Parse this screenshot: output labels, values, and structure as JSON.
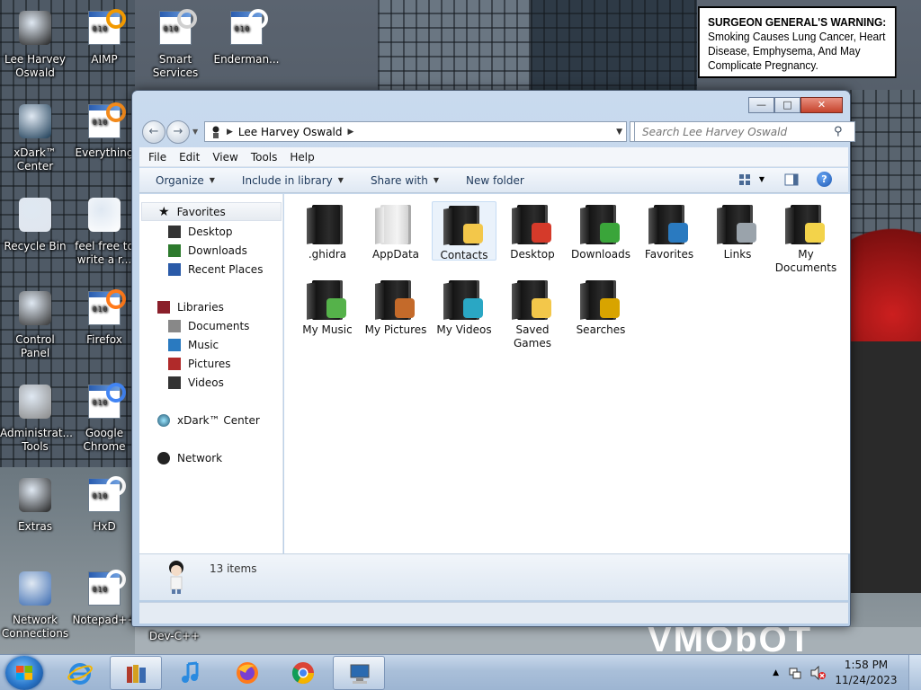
{
  "desktop": {
    "icons": [
      {
        "label": "Lee Harvey\nOswald",
        "icon": "l-avatar-icon"
      },
      {
        "label": "AIMP",
        "icon": "aimp-icon"
      },
      {
        "label": "Smart\nServices",
        "icon": "smart-services-icon"
      },
      {
        "label": "Enderman...",
        "icon": "enderman-icon"
      },
      {
        "label": "xDark™\nCenter",
        "icon": "xdark-center-icon"
      },
      {
        "label": "Everything",
        "icon": "everything-icon"
      },
      {
        "label": "Recycle Bin",
        "icon": "recycle-bin-icon"
      },
      {
        "label": "feel free to\nwrite a r...",
        "icon": "text-document-icon"
      },
      {
        "label": "Control Panel",
        "icon": "control-panel-icon"
      },
      {
        "label": "Firefox",
        "icon": "firefox-icon"
      },
      {
        "label": "Administrat...\nTools",
        "icon": "admin-tools-icon"
      },
      {
        "label": "Google\nChrome",
        "icon": "chrome-icon"
      },
      {
        "label": "Extras",
        "icon": "extras-icon"
      },
      {
        "label": "HxD",
        "icon": "hxd-icon"
      },
      {
        "label": "Network\nConnections",
        "icon": "network-connections-icon"
      },
      {
        "label": "Notepad++",
        "icon": "notepadpp-icon"
      },
      {
        "label": "Dev-C++",
        "icon": "devcpp-icon"
      }
    ],
    "warning": {
      "bold": "SURGEON GENERAL'S WARNING:",
      "text": " Smoking Causes Lung Cancer, Heart Disease, Emphysema, And May Complicate Pregnancy."
    },
    "wallpaper_text": "VMObOT"
  },
  "window": {
    "address": {
      "path": "Lee Harvey Oswald"
    },
    "search": {
      "placeholder": "Search Lee Harvey Oswald"
    },
    "menu": [
      "File",
      "Edit",
      "View",
      "Tools",
      "Help"
    ],
    "commands": {
      "organize": "Organize",
      "include": "Include in library",
      "share": "Share with",
      "new_folder": "New folder"
    },
    "nav": {
      "favorites": "Favorites",
      "fav_items": [
        "Desktop",
        "Downloads",
        "Recent Places"
      ],
      "libraries": "Libraries",
      "lib_items": [
        "Documents",
        "Music",
        "Pictures",
        "Videos"
      ],
      "xdark": "xDark™ Center",
      "network": "Network"
    },
    "items": [
      {
        "name": ".ghidra",
        "style": "dark"
      },
      {
        "name": "AppData",
        "style": "light"
      },
      {
        "name": "Contacts",
        "style": "dark",
        "selected": true
      },
      {
        "name": "Desktop",
        "style": "dark"
      },
      {
        "name": "Downloads",
        "style": "dark"
      },
      {
        "name": "Favorites",
        "style": "dark"
      },
      {
        "name": "Links",
        "style": "dark"
      },
      {
        "name": "My\nDocuments",
        "style": "dark"
      },
      {
        "name": "My Music",
        "style": "dark"
      },
      {
        "name": "My Pictures",
        "style": "dark"
      },
      {
        "name": "My Videos",
        "style": "dark"
      },
      {
        "name": "Saved\nGames",
        "style": "dark"
      },
      {
        "name": "Searches",
        "style": "dark"
      }
    ],
    "details": {
      "count": "13 items"
    }
  },
  "taskbar": {
    "clock_time": "1:58 PM",
    "clock_date": "11/24/2023"
  },
  "colors": {
    "accent": "#2b6ac0",
    "selection": "#eaf2fb"
  }
}
